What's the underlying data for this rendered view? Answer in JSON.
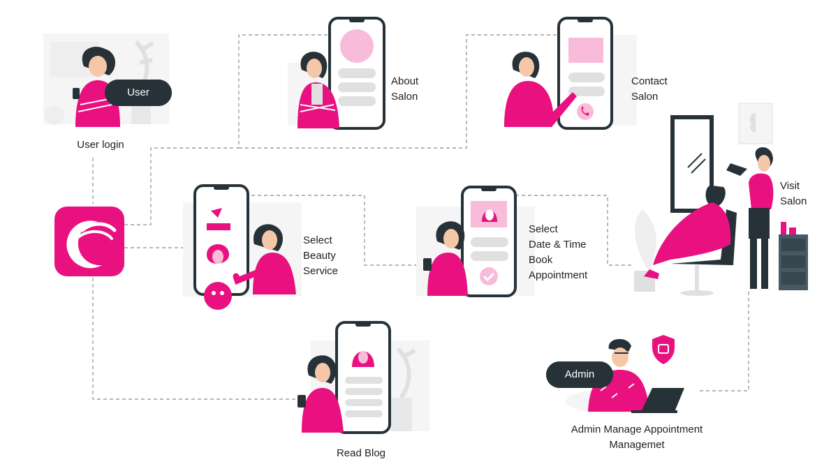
{
  "colors": {
    "accent": "#e8117f",
    "dark": "#263238",
    "connector": "#9e9e9e",
    "ghost": "#eeeeee",
    "skin": "#f5c7a9"
  },
  "nodes": {
    "user_login": {
      "pill": "User",
      "caption": [
        "User login"
      ]
    },
    "app_logo": {
      "icon": "salon-logo-icon"
    },
    "about_salon": {
      "caption": [
        "About",
        "Salon"
      ]
    },
    "contact_salon": {
      "caption": [
        "Contact",
        "Salon"
      ]
    },
    "select_beauty_service": {
      "caption": [
        "Select",
        "Beauty",
        "Service"
      ]
    },
    "book_appointment": {
      "caption": [
        "Select",
        "Date & Time",
        "Book",
        "Appointment"
      ]
    },
    "visit_salon": {
      "caption": [
        "Visit",
        "Salon"
      ]
    },
    "read_blog": {
      "caption": [
        "Read Blog"
      ]
    },
    "admin": {
      "pill": "Admin",
      "caption": [
        "Admin Manage Appointment",
        "Managemet"
      ]
    }
  }
}
